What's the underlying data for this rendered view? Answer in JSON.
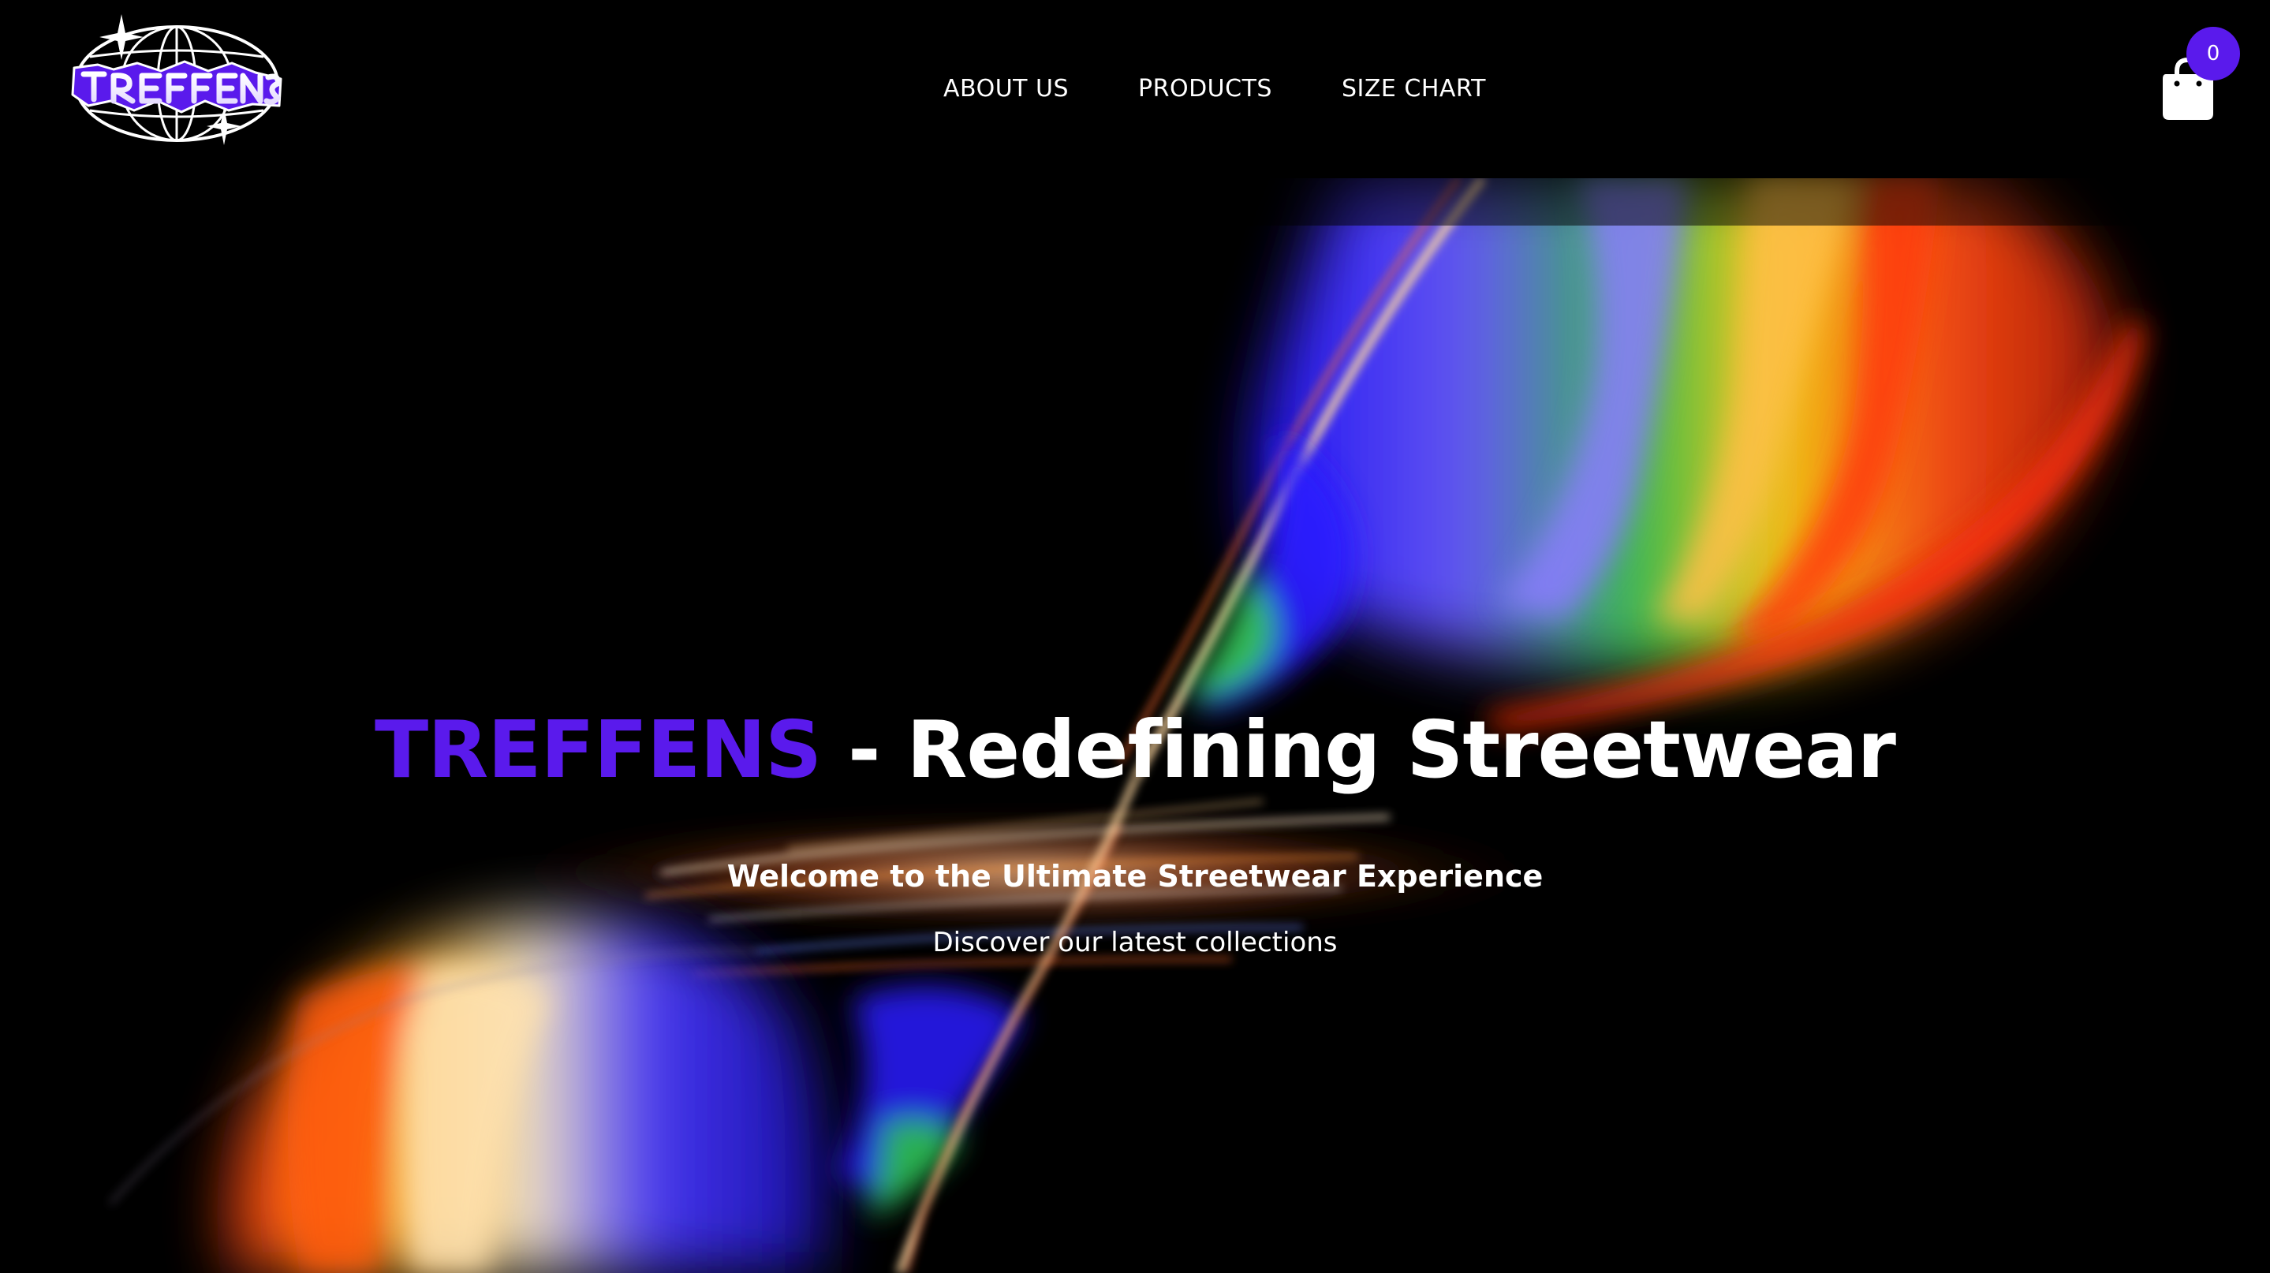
{
  "brand": {
    "logo_text": "TREFFENS",
    "accent_color": "#5a1aec"
  },
  "nav": {
    "items": [
      {
        "label": "ABOUT US"
      },
      {
        "label": "PRODUCTS"
      },
      {
        "label": "SIZE CHART"
      }
    ]
  },
  "cart": {
    "count": "0",
    "icon": "shopping-bag-icon"
  },
  "hero": {
    "title_brand": "TREFFENS",
    "title_rest": " - Redefining Streetwear",
    "subtitle": "Welcome to the Ultimate Streetwear Experience",
    "tagline": "Discover our latest collections"
  }
}
